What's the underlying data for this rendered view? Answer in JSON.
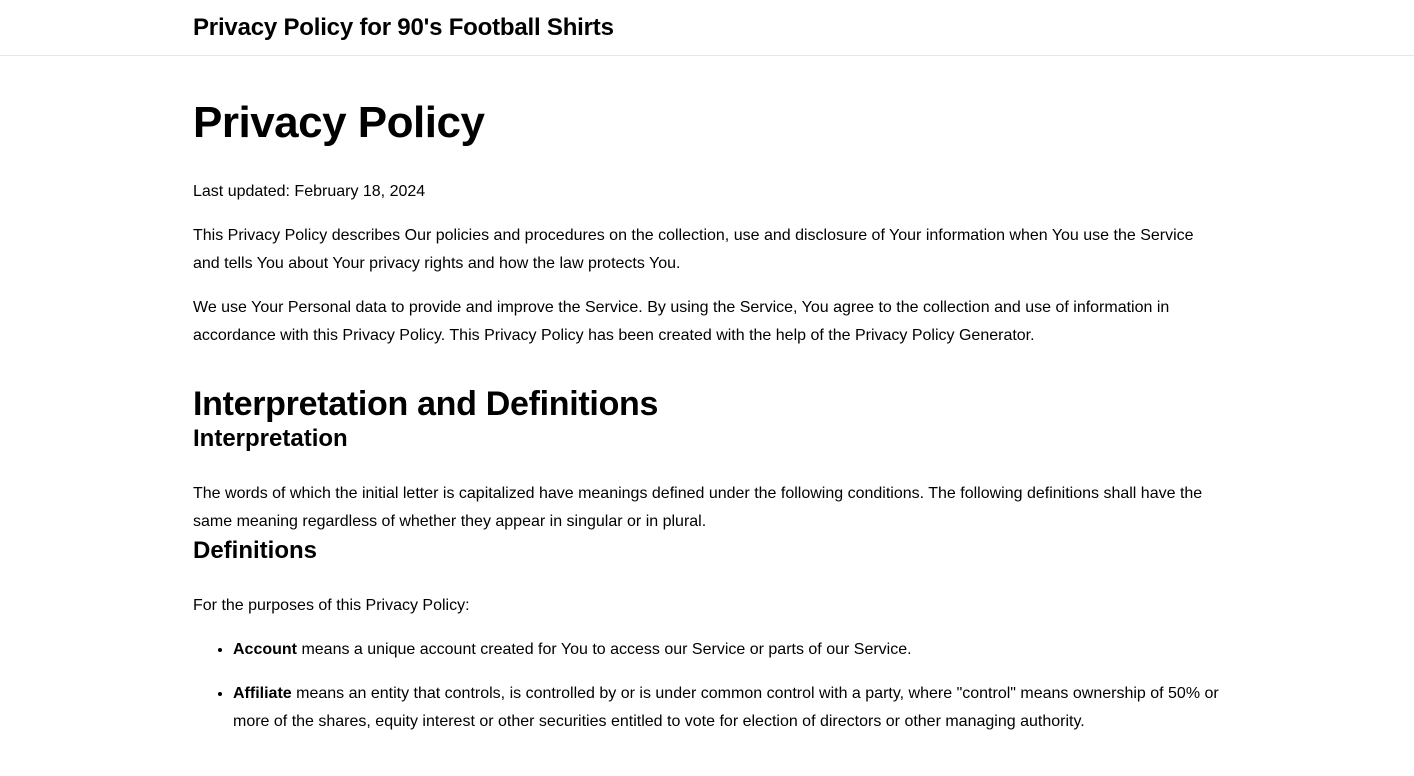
{
  "header": {
    "site_title": "Privacy Policy for 90's Football Shirts"
  },
  "main": {
    "title": "Privacy Policy",
    "last_updated": "Last updated: February 18, 2024",
    "intro_1": "This Privacy Policy describes Our policies and procedures on the collection, use and disclosure of Your information when You use the Service and tells You about Your privacy rights and how the law protects You.",
    "intro_2": "We use Your Personal data to provide and improve the Service. By using the Service, You agree to the collection and use of information in accordance with this Privacy Policy. This Privacy Policy has been created with the help of the Privacy Policy Generator.",
    "section_title": "Interpretation and Definitions",
    "interpretation": {
      "heading": "Interpretation",
      "text": "The words of which the initial letter is capitalized have meanings defined under the following conditions. The following definitions shall have the same meaning regardless of whether they appear in singular or in plural."
    },
    "definitions": {
      "heading": "Definitions",
      "intro": "For the purposes of this Privacy Policy:",
      "items": [
        {
          "term": "Account",
          "text": " means a unique account created for You to access our Service or parts of our Service."
        },
        {
          "term": "Affiliate",
          "text": " means an entity that controls, is controlled by or is under common control with a party, where \"control\" means ownership of 50% or more of the shares, equity interest or other securities entitled to vote for election of directors or other managing authority."
        }
      ]
    }
  }
}
